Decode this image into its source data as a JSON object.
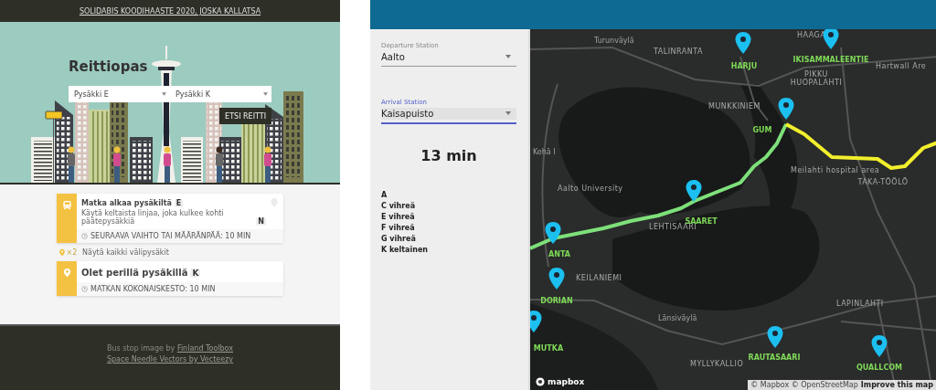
{
  "left_app": {
    "header": {
      "link": "SOLIDABIS KOODIHAASTE 2020, JOSKA KALLATSA"
    },
    "hero": {
      "title": "Reittiopas",
      "selects": [
        {
          "value": "Pysäkki E"
        },
        {
          "value": "Pysäkki K"
        }
      ],
      "button": "ETSI REITTI"
    },
    "steps": [
      {
        "kind": "start",
        "title": "Matka alkaa pysäkiltä",
        "stop": "E",
        "description": "Käytä keltaista linjaa, joka kulkee kohti päätepysäkkiä",
        "terminus": "N",
        "footer": "SEURAAVA VAIHTO TAI MÄÄRÄNPÄÄ: 10 MIN"
      },
      {
        "kind": "end",
        "title": "Olet perillä pysäkillä",
        "stop": "K",
        "footer": "MATKAN KOKONAISKESTO: 10 MIN"
      }
    ],
    "intermediate": {
      "count": "×2",
      "label": "Näytä kaikki välipysäkit"
    },
    "footer": {
      "credits": [
        {
          "text": "Bus stop image by",
          "link": "Finland Toolbox"
        },
        {
          "link": "Space Needle Vectors by Vecteezy"
        }
      ]
    }
  },
  "right_app": {
    "sidebar": {
      "fields": [
        {
          "label": "Departure Station",
          "value": "Aalto",
          "focused": false
        },
        {
          "label": "Arrival Station",
          "value": "Kaisapuisto",
          "focused": true
        }
      ],
      "duration": "13 min",
      "lines": [
        "A",
        "C vihreä",
        "E vihreä",
        "F vihreä",
        "G vihreä",
        "K keltainen"
      ]
    },
    "map": {
      "stops": [
        "HARJU",
        "IKISAMMALEENTIE",
        "GUM",
        "SAARET",
        "ANTA",
        "DORIAN",
        "MUTKA",
        "RAUTASAARI",
        "QUALLCOM"
      ],
      "places": [
        "HAAGA",
        "TALINRANTA",
        "PIKKU HUOPALAHTI",
        "MUNKKINIEM",
        "Aalto University",
        "Meilahti hospital area",
        "TAKA-TÖÖLÖ",
        "LEHTISAARI",
        "KEILANIEMI",
        "LAPINLAHTI",
        "MYLLYKALLIO",
        "Hartwall Are",
        "Turunväylä",
        "Länsiväylä",
        "Kehä I"
      ],
      "logo": "mapbox",
      "attribution": "© Mapbox © OpenStreetMap",
      "improve_link": "Improve this map"
    }
  }
}
